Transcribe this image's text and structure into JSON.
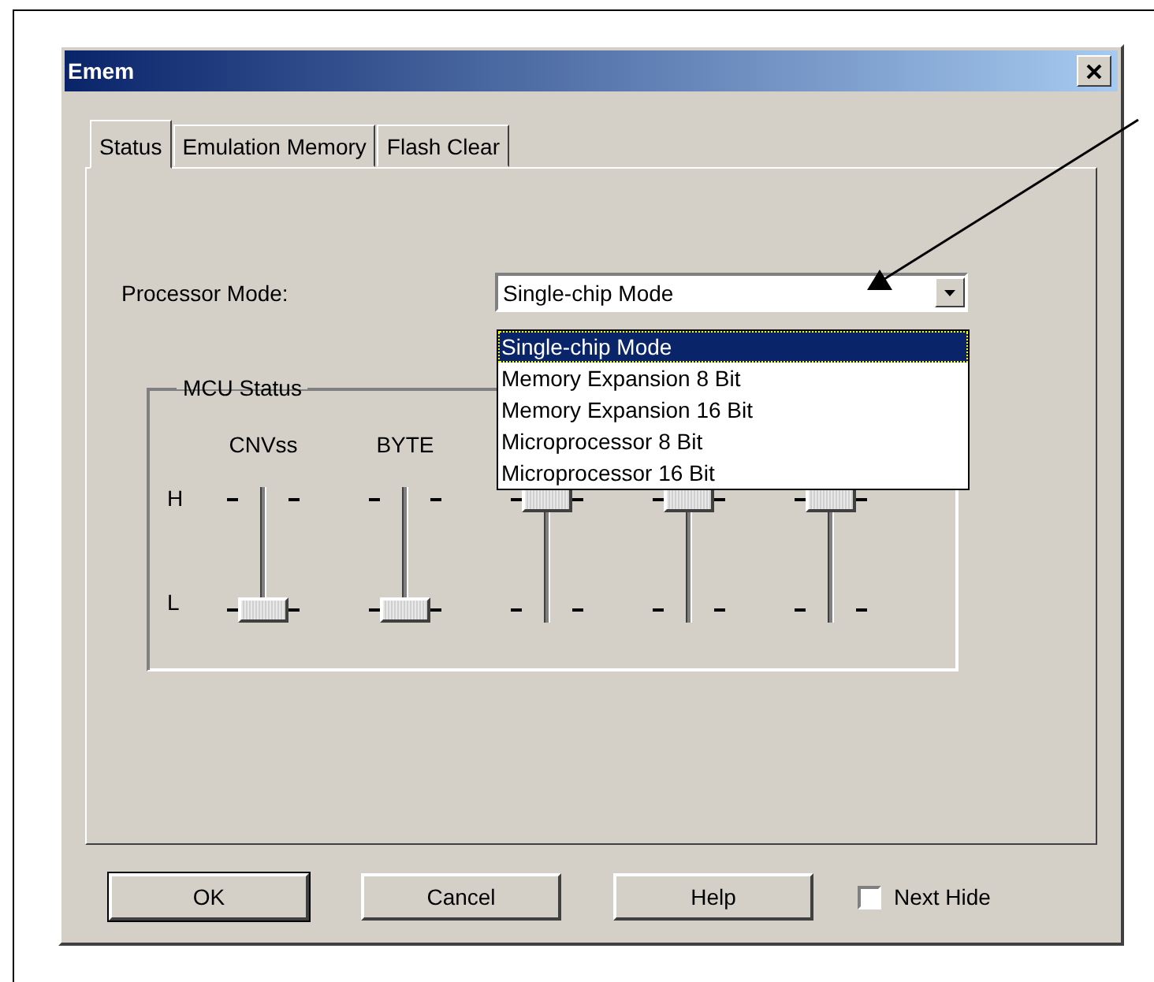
{
  "window": {
    "title": "Emem"
  },
  "tabs": [
    {
      "label": "Status",
      "selected": true
    },
    {
      "label": "Emulation Memory",
      "selected": false
    },
    {
      "label": "Flash Clear",
      "selected": false
    }
  ],
  "processor_mode": {
    "label": "Processor Mode:",
    "value": "Single-chip Mode",
    "expanded": true,
    "options": [
      {
        "label": "Single-chip Mode",
        "selected": true
      },
      {
        "label": "Memory Expansion 8 Bit",
        "selected": false
      },
      {
        "label": "Memory Expansion 16 Bit",
        "selected": false
      },
      {
        "label": "Microprocessor 8 Bit",
        "selected": false
      },
      {
        "label": "Microprocessor 16 Bit",
        "selected": false
      }
    ]
  },
  "mcu_status": {
    "title": "MCU Status",
    "high_label": "H",
    "low_label": "L",
    "sliders": [
      {
        "label": "CNVss",
        "level": 0
      },
      {
        "label": "BYTE",
        "level": 0
      },
      {
        "level": 1
      },
      {
        "level": 1
      },
      {
        "level": 1
      }
    ]
  },
  "buttons": [
    {
      "label": "OK",
      "default": true
    },
    {
      "label": "Cancel",
      "default": false
    },
    {
      "label": "Help",
      "default": false
    }
  ],
  "next_hide": {
    "label": "Next Hide",
    "checked": false
  }
}
